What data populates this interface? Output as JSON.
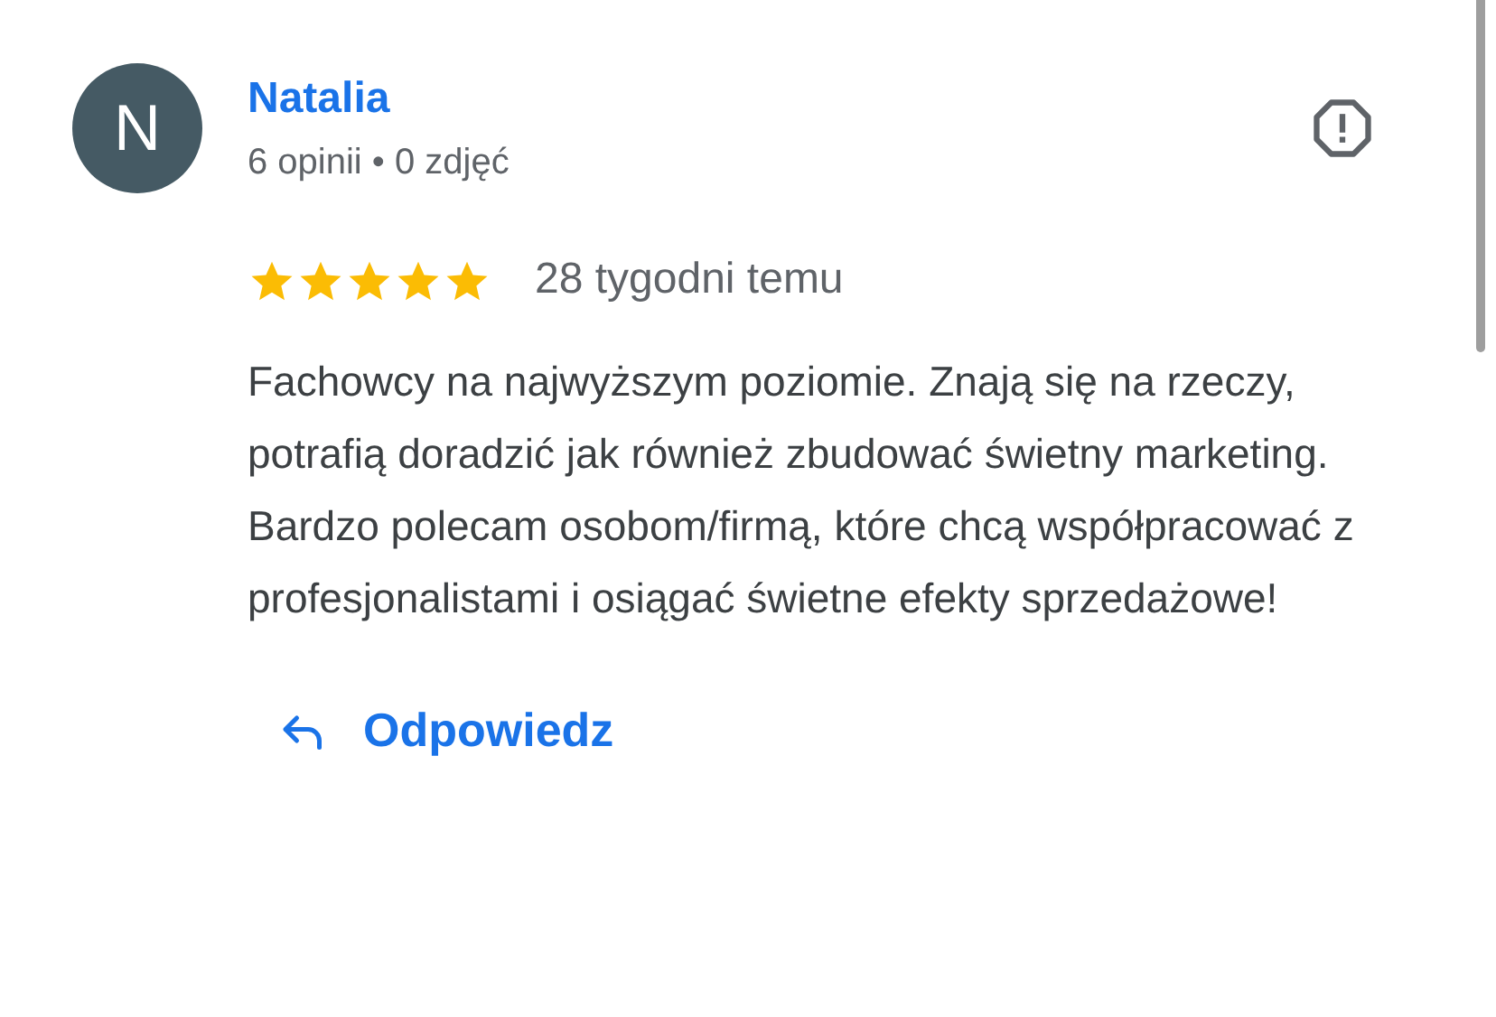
{
  "review": {
    "avatar_letter": "N",
    "author": "Natalia",
    "meta": "6 opinii • 0 zdjęć",
    "stars": 5,
    "date": "28 tygodni temu",
    "text": "Fachowcy na najwyższym poziomie. Znają się na rzeczy, potrafią doradzić jak również zbudować świetny marketing. Bardzo polecam osobom/firmą, które chcą współpracować z profesjonalistami i osiągać świetne efekty sprzedażowe!",
    "reply_button": "Odpowiedz"
  }
}
